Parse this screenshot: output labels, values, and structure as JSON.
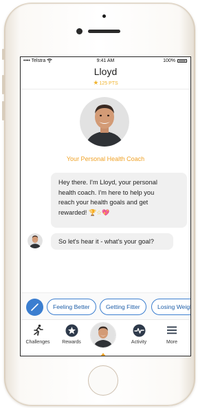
{
  "status_bar": {
    "carrier": "•••• Telstra",
    "time": "9:41 AM",
    "battery": "100%"
  },
  "header": {
    "name": "Lloyd",
    "points": "125 PTS"
  },
  "coach": {
    "title": "Your Personal Health Coach"
  },
  "messages": [
    {
      "text_lines": [
        "Hey there. I'm Lloyd, your personal",
        "health coach. I'm here to help you",
        "reach your health goals and get",
        "rewarded!"
      ]
    },
    {
      "text": "So let's hear it - what's your goal?"
    }
  ],
  "quick_replies": [
    "Feeling Better",
    "Getting Fitter",
    "Losing Weight"
  ],
  "tabs": {
    "challenges": "Challenges",
    "rewards": "Rewards",
    "activity": "Activity",
    "more": "More"
  },
  "colors": {
    "accent_orange": "#f0a226",
    "points_gold": "#f0b32c",
    "chip_blue": "#3b7ed0",
    "bubble_gray": "#f0f0f0"
  },
  "icons": [
    "wifi-icon",
    "star-icon",
    "trophy-icon",
    "heart-icon",
    "pencil-icon",
    "runner-icon",
    "star-badge-icon",
    "pulse-icon",
    "menu-icon"
  ]
}
